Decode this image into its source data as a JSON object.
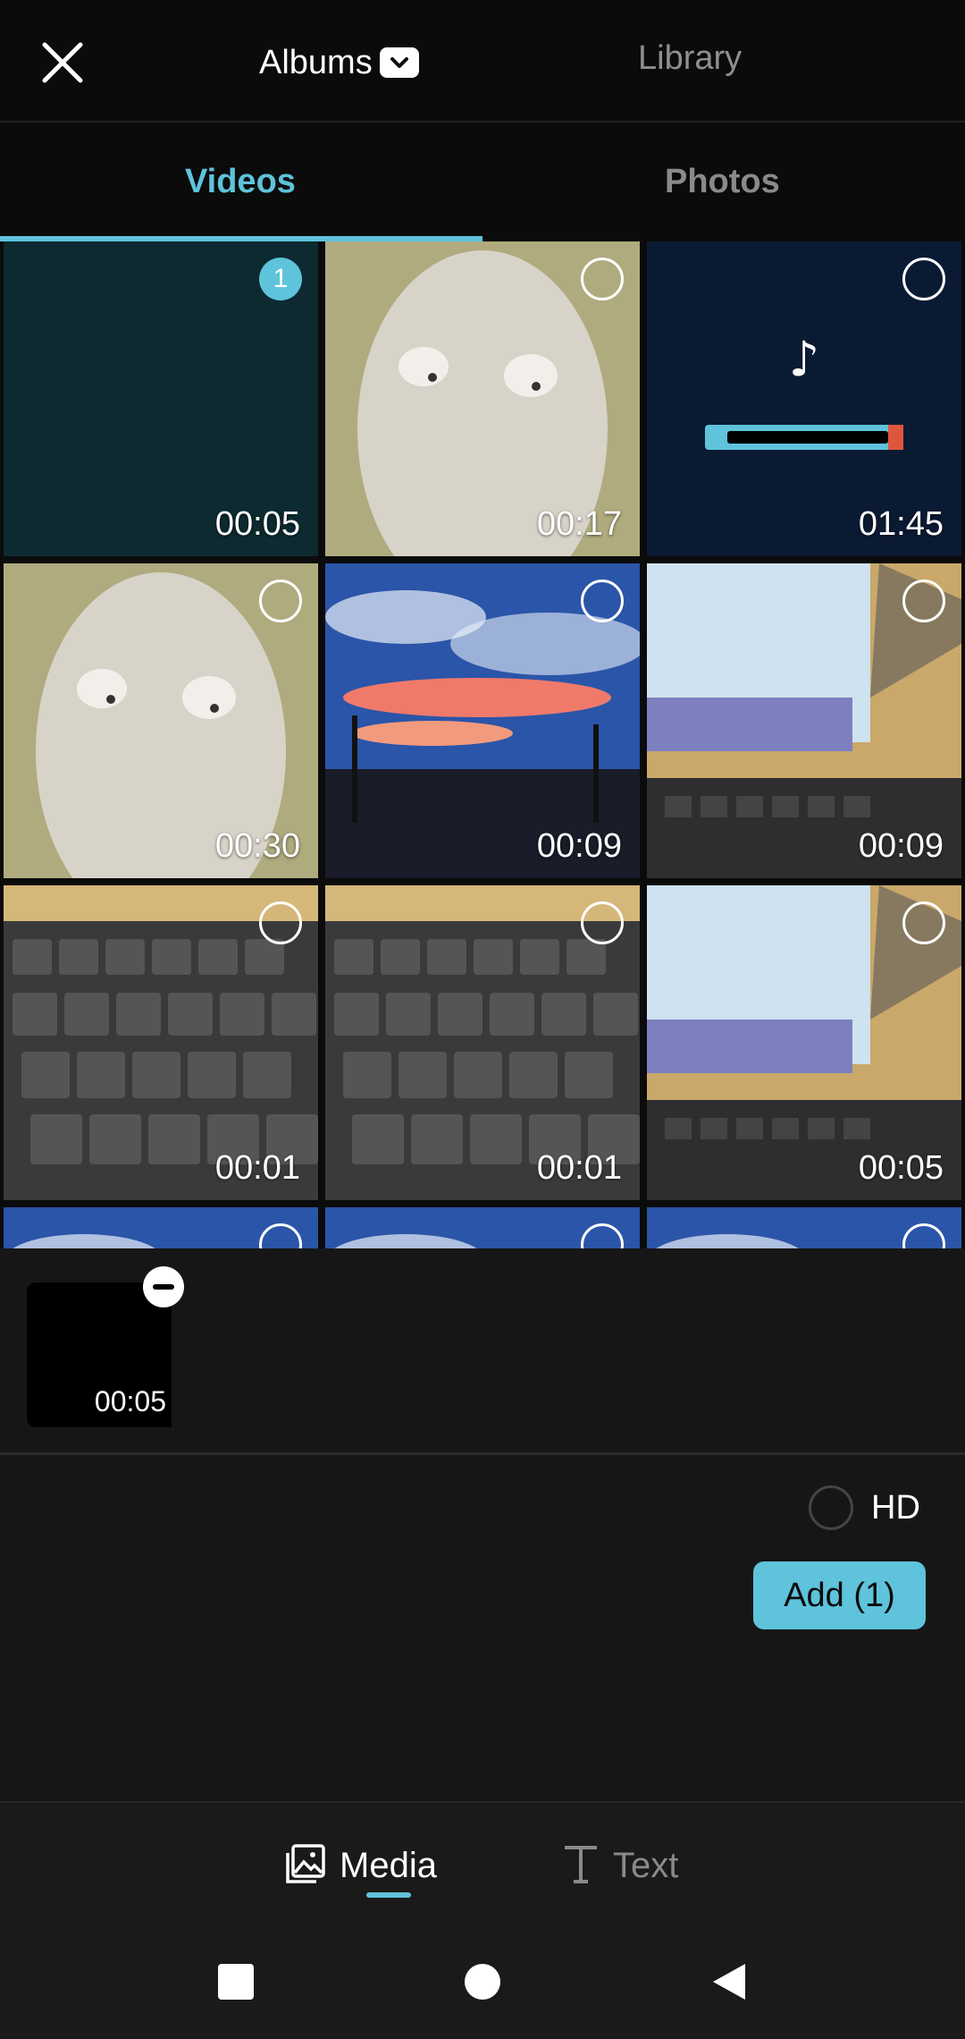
{
  "header": {
    "albums_label": "Albums",
    "library_label": "Library"
  },
  "tabs": [
    {
      "label": "Videos",
      "active": true
    },
    {
      "label": "Photos",
      "active": false
    }
  ],
  "grid": {
    "items": [
      {
        "duration": "00:05",
        "selected_index": "1",
        "scene": "dark-teal"
      },
      {
        "duration": "00:17",
        "selected_index": "",
        "scene": "cat"
      },
      {
        "duration": "01:45",
        "selected_index": "",
        "scene": "tiktok"
      },
      {
        "duration": "00:30",
        "selected_index": "",
        "scene": "cat"
      },
      {
        "duration": "00:09",
        "selected_index": "",
        "scene": "sunset"
      },
      {
        "duration": "00:09",
        "selected_index": "",
        "scene": "desk"
      },
      {
        "duration": "00:01",
        "selected_index": "",
        "scene": "keyboard"
      },
      {
        "duration": "00:01",
        "selected_index": "",
        "scene": "keyboard"
      },
      {
        "duration": "00:05",
        "selected_index": "",
        "scene": "desk"
      },
      {
        "duration": "",
        "selected_index": "",
        "scene": "sunset"
      },
      {
        "duration": "",
        "selected_index": "",
        "scene": "sunset"
      },
      {
        "duration": "",
        "selected_index": "",
        "scene": "sunset"
      }
    ]
  },
  "selection": {
    "thumb_duration": "00:05"
  },
  "hd_label": "HD",
  "add_button_label": "Add (1)",
  "bottom_nav": {
    "media_label": "Media",
    "text_label": "Text"
  },
  "colors": {
    "accent": "#5ec3db",
    "background": "#161616",
    "topbar": "#0b0b0b"
  }
}
